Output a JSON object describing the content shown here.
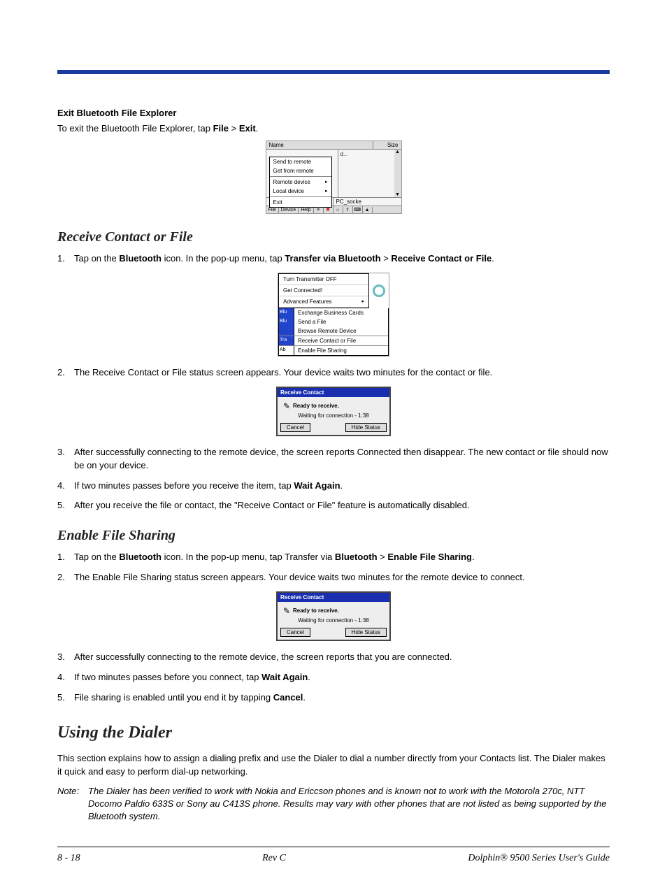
{
  "subhead1": "Exit Bluetooth File Explorer",
  "p1_a": "To exit the Bluetooth File Explorer, tap ",
  "p1_b": "File",
  "p1_c": " > ",
  "p1_d": "Exit",
  "p1_e": ".",
  "shot1": {
    "hdr_name": "Name",
    "hdr_size": "Size",
    "menu_send": "Send to remote",
    "menu_get": "Get from remote",
    "menu_remote": "Remote device",
    "menu_local": "Local device",
    "menu_exit": "Exit",
    "right_txt": "d...",
    "low_left": "",
    "low_right": "PC_socke",
    "tb_file": "File",
    "tb_device": "Device",
    "tb_help": "Help"
  },
  "h2_receive": "Receive Contact or File",
  "rcv": {
    "i1_a": "Tap on the ",
    "i1_b": "Bluetooth",
    "i1_c": " icon. In the pop-up menu, tap ",
    "i1_d": "Transfer via Bluetooth",
    "i1_e": " > ",
    "i1_f": "Receive Contact or File",
    "i1_g": ".",
    "i2": "The Receive Contact or File status screen appears. Your device waits two minutes for the contact or file.",
    "i3": "After successfully connecting to the remote device, the screen reports Connected then disappear. The new contact or file should now be on your device.",
    "i4_a": "If two minutes passes before you receive the item, tap ",
    "i4_b": "Wait Again",
    "i4_c": ".",
    "i5": "After you receive the file or contact, the \"Receive Contact or File\" feature is automatically disabled."
  },
  "shot2": {
    "m_turn": "Turn Transmitter OFF",
    "m_get": "Get Connected!",
    "m_adv": "Advanced Features",
    "l_blu1": "Blu",
    "s_exch": "Exchange Business Cards",
    "l_blu2": "Blu",
    "s_send": "Send a File",
    "s_browse": "Browse Remote Device",
    "l_tra": "Tra",
    "s_recv": "Receive Contact or File",
    "l_ab": "Ab",
    "s_enable": "Enable File Sharing"
  },
  "shot3": {
    "title": "Receive Contact",
    "ready": "Ready to receive.",
    "wait": "Waiting for connection - 1:38",
    "cancel": "Cancel",
    "hide": "Hide Status"
  },
  "h2_enable": "Enable File Sharing",
  "enb": {
    "i1_a": "Tap on the ",
    "i1_b": "Bluetooth",
    "i1_c": " icon. In the pop-up menu, tap Transfer via ",
    "i1_d": "Bluetooth",
    "i1_e": " > ",
    "i1_f": "Enable File Sharing",
    "i1_g": ".",
    "i2": "The Enable File Sharing status screen appears. Your device waits two minutes for the remote device to connect.",
    "i3": "After successfully connecting to the remote device, the screen reports that you are connected.",
    "i4_a": "If two minutes passes before you connect, tap ",
    "i4_b": "Wait Again",
    "i4_c": ".",
    "i5_a": "File sharing is enabled until you end it by tapping ",
    "i5_b": "Cancel",
    "i5_c": "."
  },
  "h1_dialer": "Using the Dialer",
  "dialer_p": "This section explains how to assign a dialing prefix and use the Dialer to dial a number directly from your Contacts list. The Dialer makes it quick and easy to perform dial-up networking.",
  "note_lbl": "Note:",
  "note_txt": "The Dialer has been verified to work with Nokia and Ericcson phones and is known not to work with the Motorola 270c, NTT Docomo Paldio 633S or Sony au C413S phone. Results may vary with other phones that are not listed as being supported by the Bluetooth system.",
  "footer": {
    "left": "8 - 18",
    "mid": "Rev C",
    "right": "Dolphin® 9500 Series User's Guide"
  },
  "nums": {
    "n1": "1.",
    "n2": "2.",
    "n3": "3.",
    "n4": "4.",
    "n5": "5."
  }
}
